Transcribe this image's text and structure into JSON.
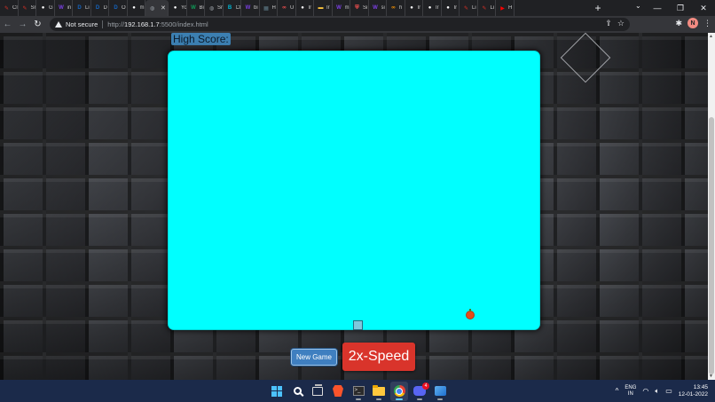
{
  "browser": {
    "tabs": [
      {
        "label": "Cl",
        "icon": "pencil-icon",
        "color": "#d93025"
      },
      {
        "label": "Sr",
        "icon": "pencil-icon",
        "color": "#d93025"
      },
      {
        "label": "G",
        "icon": "github-icon",
        "color": "#ffffff"
      },
      {
        "label": "in",
        "icon": "w-icon",
        "color": "#7b3fe4"
      },
      {
        "label": "Li",
        "icon": "d-icon",
        "color": "#1565c0"
      },
      {
        "label": "D",
        "icon": "d-icon",
        "color": "#1565c0"
      },
      {
        "label": "O",
        "icon": "d-icon",
        "color": "#1565c0"
      },
      {
        "label": "m",
        "icon": "github-icon",
        "color": "#ffffff"
      },
      {
        "label": "",
        "icon": "globe-icon",
        "color": "#9aa0a6",
        "active": true
      },
      {
        "label": "Yo",
        "icon": "github-icon",
        "color": "#ffffff"
      },
      {
        "label": "Bi",
        "icon": "w-icon",
        "color": "#0f9d58"
      },
      {
        "label": "Sr",
        "icon": "globe-icon",
        "color": "#9aa0a6"
      },
      {
        "label": "Cl",
        "icon": "b-icon",
        "color": "#00b8d4"
      },
      {
        "label": "bi",
        "icon": "w-icon",
        "color": "#7b3fe4"
      },
      {
        "label": "H",
        "icon": "grid-icon",
        "color": "#607d8b"
      },
      {
        "label": "U",
        "icon": "infinity-icon",
        "color": "#ff5252"
      },
      {
        "label": "Ir",
        "icon": "medium-icon",
        "color": "#ffffff"
      },
      {
        "label": "Ir",
        "icon": "folder-icon",
        "color": "#ffc83d"
      },
      {
        "label": "m",
        "icon": "w-icon",
        "color": "#7b3fe4"
      },
      {
        "label": "Si",
        "icon": "shield-icon",
        "color": "#ff5252"
      },
      {
        "label": "si",
        "icon": "w-icon",
        "color": "#7b3fe4"
      },
      {
        "label": "h",
        "icon": "infinity-icon",
        "color": "#ff9800"
      },
      {
        "label": "Ir",
        "icon": "medium-icon",
        "color": "#ffffff"
      },
      {
        "label": "Ir",
        "icon": "medium-icon",
        "color": "#ffffff"
      },
      {
        "label": "Ir",
        "icon": "medium-icon",
        "color": "#ffffff"
      },
      {
        "label": "Li",
        "icon": "pencil-icon",
        "color": "#d93025"
      },
      {
        "label": "Li",
        "icon": "pencil-icon",
        "color": "#d93025"
      },
      {
        "label": "H",
        "icon": "youtube-icon",
        "color": "#ff0000"
      }
    ],
    "active_close": "✕",
    "new_tab": "+",
    "address": {
      "security_label": "Not secure",
      "url_prefix": "http://",
      "url_host": "192.168.1.7",
      "url_rest": ":5500/index.html"
    },
    "profile_initial": "N"
  },
  "game": {
    "high_score_label": "High Score:",
    "new_game_label": "New Game",
    "speed_label": "2x-Speed",
    "board_color": "#00ffff"
  },
  "taskbar": {
    "language": {
      "line1": "ENG",
      "line2": "IN"
    },
    "time": "13:45",
    "date": "12-01-2022",
    "discord_badge": "4"
  }
}
